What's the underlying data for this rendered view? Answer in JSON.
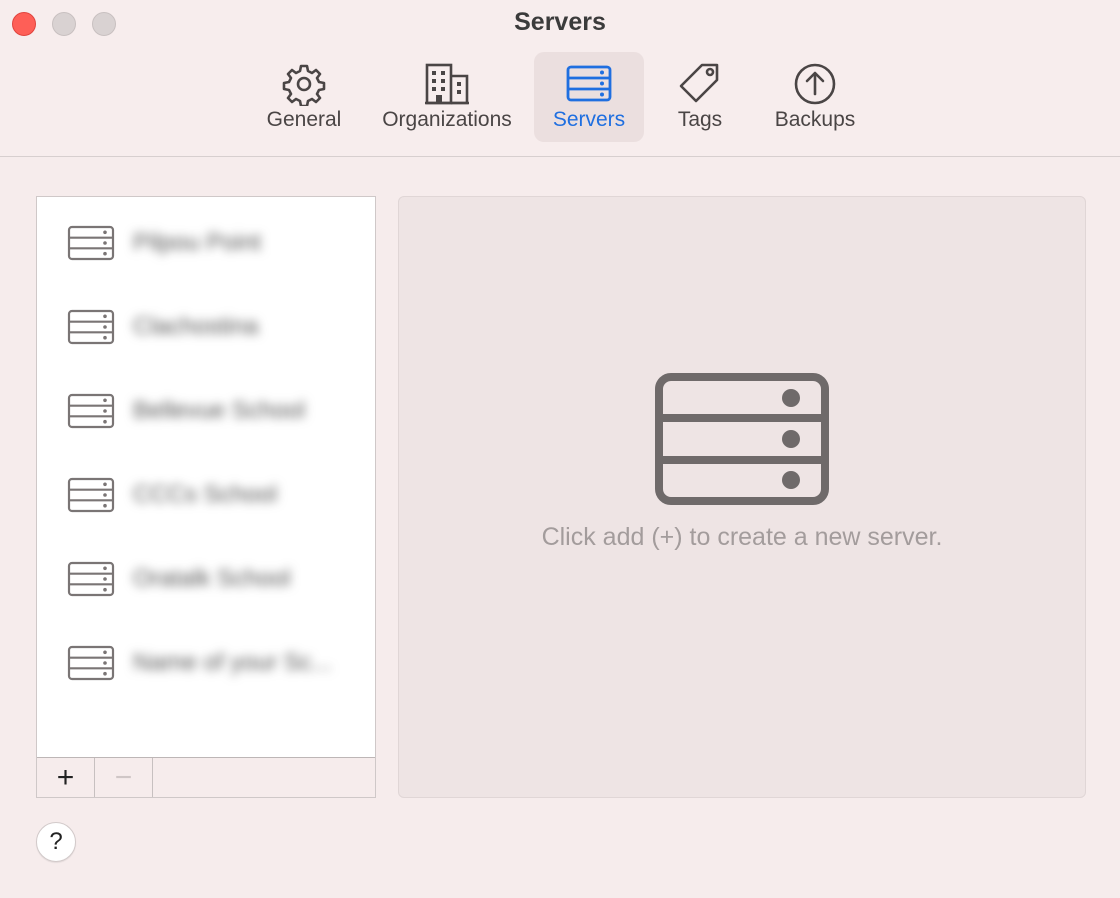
{
  "window": {
    "title": "Servers"
  },
  "toolbar": {
    "tabs": [
      {
        "label": "General",
        "icon": "gear-icon"
      },
      {
        "label": "Organizations",
        "icon": "building-icon"
      },
      {
        "label": "Servers",
        "icon": "server-icon",
        "active": true
      },
      {
        "label": "Tags",
        "icon": "tag-icon"
      },
      {
        "label": "Backups",
        "icon": "upload-circle-icon"
      }
    ]
  },
  "servers": {
    "items": [
      {
        "label": "Pilpou Point"
      },
      {
        "label": "Clachostina"
      },
      {
        "label": "Bellevue School"
      },
      {
        "label": "CCCs School"
      },
      {
        "label": "Oratalk School"
      },
      {
        "label": "Name of your Sc..."
      }
    ],
    "add_label": "+",
    "remove_label": "−"
  },
  "detail": {
    "hint": "Click add (+) to create a new server."
  },
  "help": {
    "label": "?"
  },
  "colors": {
    "accent": "#1f6fe0",
    "close": "#fe5f57",
    "background": "#f6ecec"
  }
}
